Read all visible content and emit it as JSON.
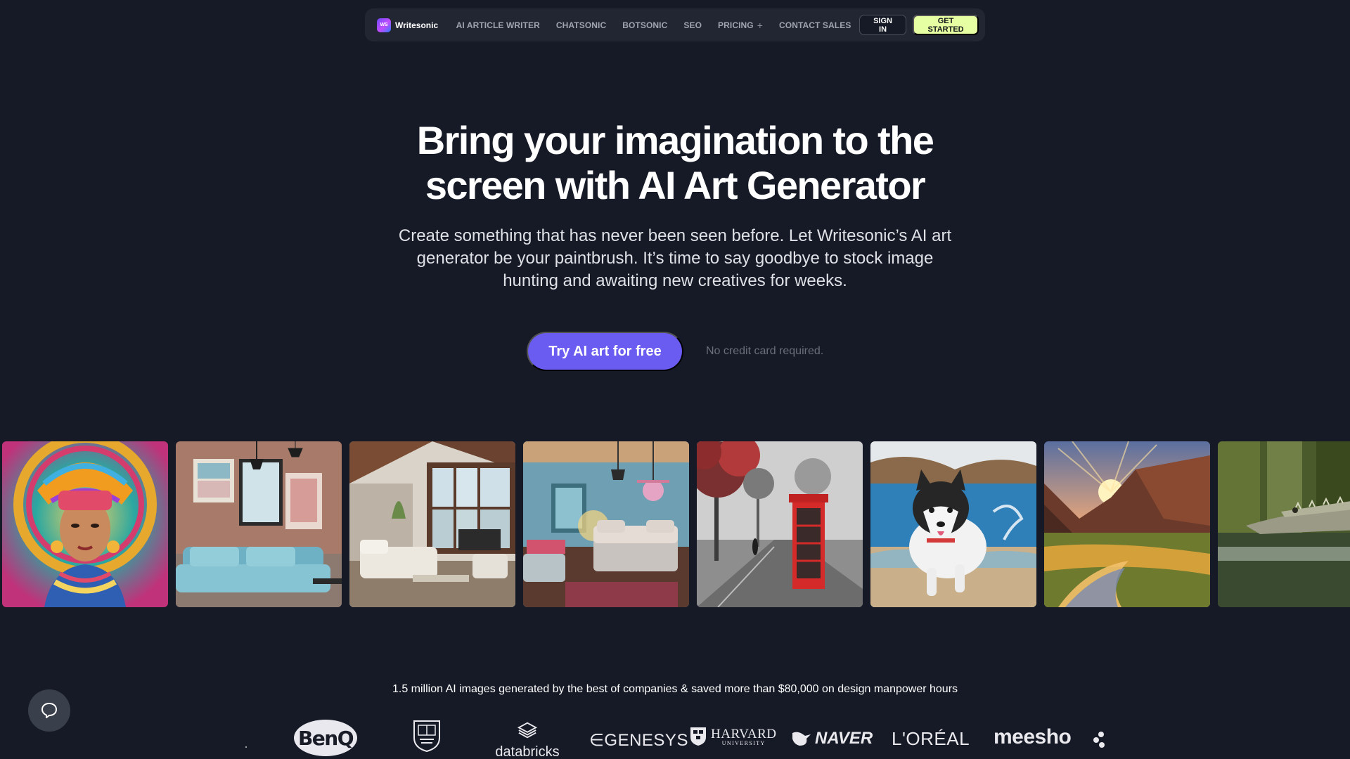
{
  "nav": {
    "brand_name": "Writesonic",
    "brand_badge": "WS",
    "links": [
      "AI ARTICLE WRITER",
      "CHATSONIC",
      "BOTSONIC",
      "SEO",
      "PRICING",
      "CONTACT SALES"
    ],
    "pricing_expand_icon": "plus-icon",
    "sign_in_label": "SIGN IN",
    "get_started_label": "GET STARTED"
  },
  "hero": {
    "title_lines": [
      "Bring your imagination to the",
      "screen with AI Art Generator"
    ],
    "subtitle_lines": [
      "Create something that has never been seen before. Let Writesonic’s AI art",
      "generator be your paintbrush. It’s time to say goodbye to stock image",
      "hunting and awaiting new creatives for weeks."
    ],
    "cta_label": "Try AI art for free",
    "cta_note": "No credit card required."
  },
  "gallery": {
    "images": [
      "aztec-goddess-portrait",
      "blue-sofa-living-room",
      "modern-living-room",
      "cozy-bedroom",
      "red-phone-booth-street",
      "husky-on-beach",
      "mountain-sunset-river",
      "crocodile-in-water"
    ]
  },
  "social_proof": {
    "text": "1.5 million AI images generated by the best of companies & saved more than $80,000 on design manpower hours",
    "logos": {
      "benq": "BenQ",
      "databricks": "databricks",
      "genesys": "GENESYS",
      "harvard_main": "HARVARD",
      "harvard_sub": "UNIVERSITY",
      "naver": "NAVER",
      "loreal": "L'ORÉAL",
      "meesho": "meesho"
    }
  },
  "colors": {
    "background": "#161a26",
    "nav_bg": "#222633",
    "cta": "#6a5cf0",
    "get_started": "#e6ffa3"
  },
  "chat_widget": {
    "icon": "chat-bubble-icon"
  }
}
